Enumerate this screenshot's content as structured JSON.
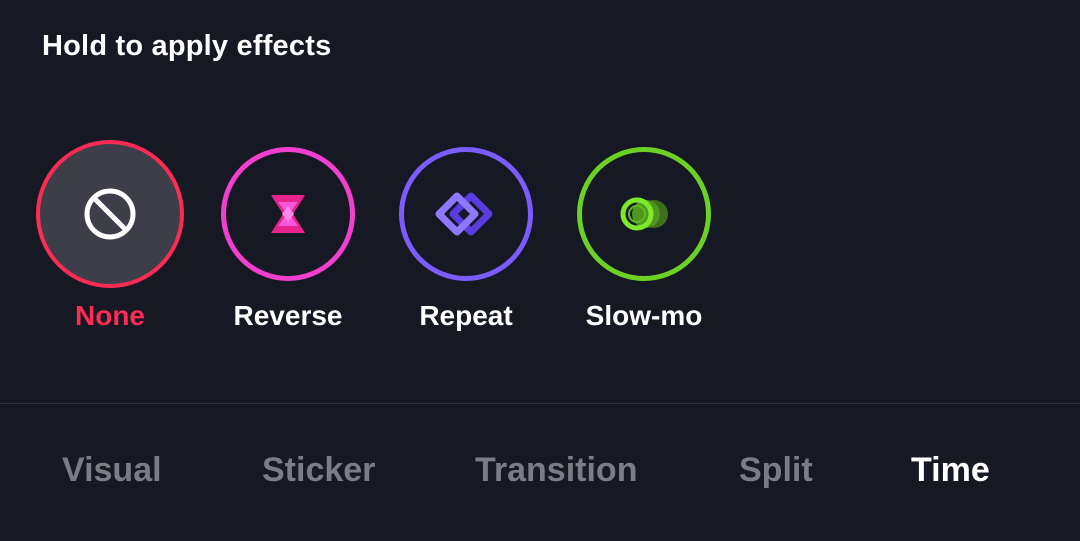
{
  "header": {
    "title": "Hold to apply effects"
  },
  "effects": [
    {
      "label": "None",
      "icon": "none-icon",
      "color": "#fe2c55",
      "selected": true
    },
    {
      "label": "Reverse",
      "icon": "reverse-icon",
      "color": "#f33fd0",
      "selected": false
    },
    {
      "label": "Repeat",
      "icon": "repeat-icon",
      "color": "#7c5cff",
      "selected": false
    },
    {
      "label": "Slow-mo",
      "icon": "slow-mo-icon",
      "color": "#6bd125",
      "selected": false
    }
  ],
  "tabs": [
    {
      "label": "Visual",
      "active": false
    },
    {
      "label": "Sticker",
      "active": false
    },
    {
      "label": "Transition",
      "active": false
    },
    {
      "label": "Split",
      "active": false
    },
    {
      "label": "Time",
      "active": true
    }
  ],
  "colors": {
    "background": "#161823",
    "accent": "#fe2c55",
    "tab_inactive": "#7b7c85",
    "tab_active": "#ffffff"
  }
}
